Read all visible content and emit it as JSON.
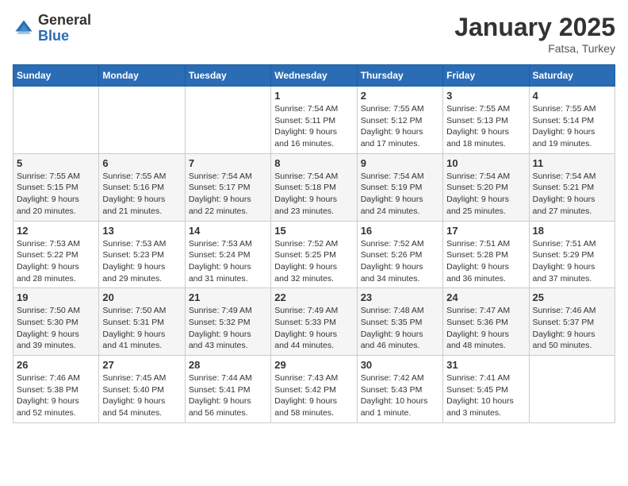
{
  "header": {
    "logo_general": "General",
    "logo_blue": "Blue",
    "month": "January 2025",
    "location": "Fatsa, Turkey"
  },
  "weekdays": [
    "Sunday",
    "Monday",
    "Tuesday",
    "Wednesday",
    "Thursday",
    "Friday",
    "Saturday"
  ],
  "weeks": [
    [
      {
        "day": "",
        "info": ""
      },
      {
        "day": "",
        "info": ""
      },
      {
        "day": "",
        "info": ""
      },
      {
        "day": "1",
        "info": "Sunrise: 7:54 AM\nSunset: 5:11 PM\nDaylight: 9 hours\nand 16 minutes."
      },
      {
        "day": "2",
        "info": "Sunrise: 7:55 AM\nSunset: 5:12 PM\nDaylight: 9 hours\nand 17 minutes."
      },
      {
        "day": "3",
        "info": "Sunrise: 7:55 AM\nSunset: 5:13 PM\nDaylight: 9 hours\nand 18 minutes."
      },
      {
        "day": "4",
        "info": "Sunrise: 7:55 AM\nSunset: 5:14 PM\nDaylight: 9 hours\nand 19 minutes."
      }
    ],
    [
      {
        "day": "5",
        "info": "Sunrise: 7:55 AM\nSunset: 5:15 PM\nDaylight: 9 hours\nand 20 minutes."
      },
      {
        "day": "6",
        "info": "Sunrise: 7:55 AM\nSunset: 5:16 PM\nDaylight: 9 hours\nand 21 minutes."
      },
      {
        "day": "7",
        "info": "Sunrise: 7:54 AM\nSunset: 5:17 PM\nDaylight: 9 hours\nand 22 minutes."
      },
      {
        "day": "8",
        "info": "Sunrise: 7:54 AM\nSunset: 5:18 PM\nDaylight: 9 hours\nand 23 minutes."
      },
      {
        "day": "9",
        "info": "Sunrise: 7:54 AM\nSunset: 5:19 PM\nDaylight: 9 hours\nand 24 minutes."
      },
      {
        "day": "10",
        "info": "Sunrise: 7:54 AM\nSunset: 5:20 PM\nDaylight: 9 hours\nand 25 minutes."
      },
      {
        "day": "11",
        "info": "Sunrise: 7:54 AM\nSunset: 5:21 PM\nDaylight: 9 hours\nand 27 minutes."
      }
    ],
    [
      {
        "day": "12",
        "info": "Sunrise: 7:53 AM\nSunset: 5:22 PM\nDaylight: 9 hours\nand 28 minutes."
      },
      {
        "day": "13",
        "info": "Sunrise: 7:53 AM\nSunset: 5:23 PM\nDaylight: 9 hours\nand 29 minutes."
      },
      {
        "day": "14",
        "info": "Sunrise: 7:53 AM\nSunset: 5:24 PM\nDaylight: 9 hours\nand 31 minutes."
      },
      {
        "day": "15",
        "info": "Sunrise: 7:52 AM\nSunset: 5:25 PM\nDaylight: 9 hours\nand 32 minutes."
      },
      {
        "day": "16",
        "info": "Sunrise: 7:52 AM\nSunset: 5:26 PM\nDaylight: 9 hours\nand 34 minutes."
      },
      {
        "day": "17",
        "info": "Sunrise: 7:51 AM\nSunset: 5:28 PM\nDaylight: 9 hours\nand 36 minutes."
      },
      {
        "day": "18",
        "info": "Sunrise: 7:51 AM\nSunset: 5:29 PM\nDaylight: 9 hours\nand 37 minutes."
      }
    ],
    [
      {
        "day": "19",
        "info": "Sunrise: 7:50 AM\nSunset: 5:30 PM\nDaylight: 9 hours\nand 39 minutes."
      },
      {
        "day": "20",
        "info": "Sunrise: 7:50 AM\nSunset: 5:31 PM\nDaylight: 9 hours\nand 41 minutes."
      },
      {
        "day": "21",
        "info": "Sunrise: 7:49 AM\nSunset: 5:32 PM\nDaylight: 9 hours\nand 43 minutes."
      },
      {
        "day": "22",
        "info": "Sunrise: 7:49 AM\nSunset: 5:33 PM\nDaylight: 9 hours\nand 44 minutes."
      },
      {
        "day": "23",
        "info": "Sunrise: 7:48 AM\nSunset: 5:35 PM\nDaylight: 9 hours\nand 46 minutes."
      },
      {
        "day": "24",
        "info": "Sunrise: 7:47 AM\nSunset: 5:36 PM\nDaylight: 9 hours\nand 48 minutes."
      },
      {
        "day": "25",
        "info": "Sunrise: 7:46 AM\nSunset: 5:37 PM\nDaylight: 9 hours\nand 50 minutes."
      }
    ],
    [
      {
        "day": "26",
        "info": "Sunrise: 7:46 AM\nSunset: 5:38 PM\nDaylight: 9 hours\nand 52 minutes."
      },
      {
        "day": "27",
        "info": "Sunrise: 7:45 AM\nSunset: 5:40 PM\nDaylight: 9 hours\nand 54 minutes."
      },
      {
        "day": "28",
        "info": "Sunrise: 7:44 AM\nSunset: 5:41 PM\nDaylight: 9 hours\nand 56 minutes."
      },
      {
        "day": "29",
        "info": "Sunrise: 7:43 AM\nSunset: 5:42 PM\nDaylight: 9 hours\nand 58 minutes."
      },
      {
        "day": "30",
        "info": "Sunrise: 7:42 AM\nSunset: 5:43 PM\nDaylight: 10 hours\nand 1 minute."
      },
      {
        "day": "31",
        "info": "Sunrise: 7:41 AM\nSunset: 5:45 PM\nDaylight: 10 hours\nand 3 minutes."
      },
      {
        "day": "",
        "info": ""
      }
    ]
  ]
}
